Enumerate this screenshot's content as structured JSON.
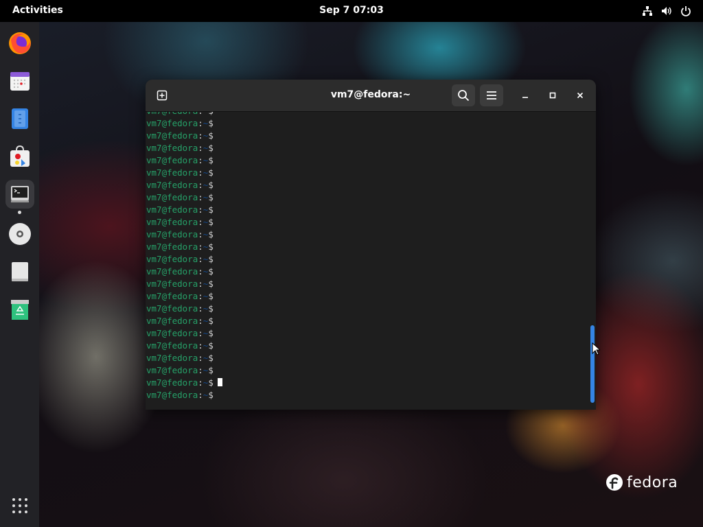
{
  "topbar": {
    "activities_label": "Activities",
    "clock": "Sep 7  07:03",
    "icons": [
      "network-icon",
      "volume-icon",
      "power-icon"
    ]
  },
  "dock": {
    "items": [
      {
        "name": "firefox",
        "icon": "firefox-icon",
        "active": false
      },
      {
        "name": "calendar",
        "icon": "calendar-icon",
        "active": false
      },
      {
        "name": "files",
        "icon": "files-icon",
        "active": false
      },
      {
        "name": "software",
        "icon": "software-icon",
        "active": false
      },
      {
        "name": "terminal",
        "icon": "terminal-icon",
        "active": true
      },
      {
        "name": "disc",
        "icon": "disc-icon",
        "active": false
      },
      {
        "name": "text-editor",
        "icon": "text-editor-icon",
        "active": false
      },
      {
        "name": "trash",
        "icon": "trash-icon",
        "active": false
      }
    ],
    "app_grid_icon": "app-grid-icon"
  },
  "terminal": {
    "title": "vm7@fedora:~",
    "prompt_user": "vm7@fedora",
    "prompt_sep": ":",
    "prompt_path": "~",
    "prompt_symbol": "$",
    "line_count": 24,
    "scroll_position": 0.98,
    "scroll_visible_fraction": 0.26
  },
  "colors": {
    "prompt_green": "#26a269",
    "prompt_blue": "#12488b",
    "accent_blue": "#3584e4",
    "terminal_bg": "#1e1e1e"
  },
  "wallpaper": {
    "brand": "fedora"
  }
}
